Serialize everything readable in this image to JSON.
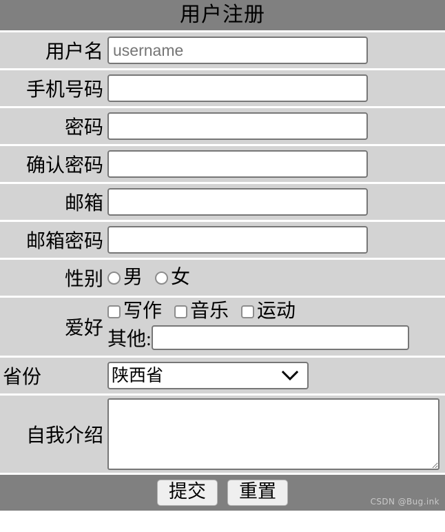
{
  "page": {
    "title": "用户注册",
    "watermark": "CSDN @Bug.ink"
  },
  "fields": {
    "username": {
      "label": "用户名",
      "placeholder": "username",
      "value": ""
    },
    "phone": {
      "label": "手机号码",
      "value": ""
    },
    "password": {
      "label": "密码",
      "value": ""
    },
    "confirm_password": {
      "label": "确认密码",
      "value": ""
    },
    "email": {
      "label": "邮箱",
      "value": ""
    },
    "email_password": {
      "label": "邮箱密码",
      "value": ""
    },
    "gender": {
      "label": "性别",
      "options": [
        {
          "label": "男",
          "checked": false
        },
        {
          "label": "女",
          "checked": false
        }
      ]
    },
    "hobby": {
      "label": "爱好",
      "options": [
        {
          "label": "写作",
          "checked": false
        },
        {
          "label": "音乐",
          "checked": false
        },
        {
          "label": "运动",
          "checked": false
        }
      ],
      "other_label": "其他:",
      "other_value": ""
    },
    "province": {
      "label": "省份",
      "selected": "陕西省",
      "options": [
        "陕西省"
      ]
    },
    "intro": {
      "label": "自我介绍",
      "value": ""
    }
  },
  "buttons": {
    "submit": "提交",
    "reset": "重置"
  },
  "colors": {
    "header_bar": "#808080",
    "row_bg": "#d3d3d3",
    "field_border": "#767676",
    "watermark": "#c9c9c9"
  }
}
